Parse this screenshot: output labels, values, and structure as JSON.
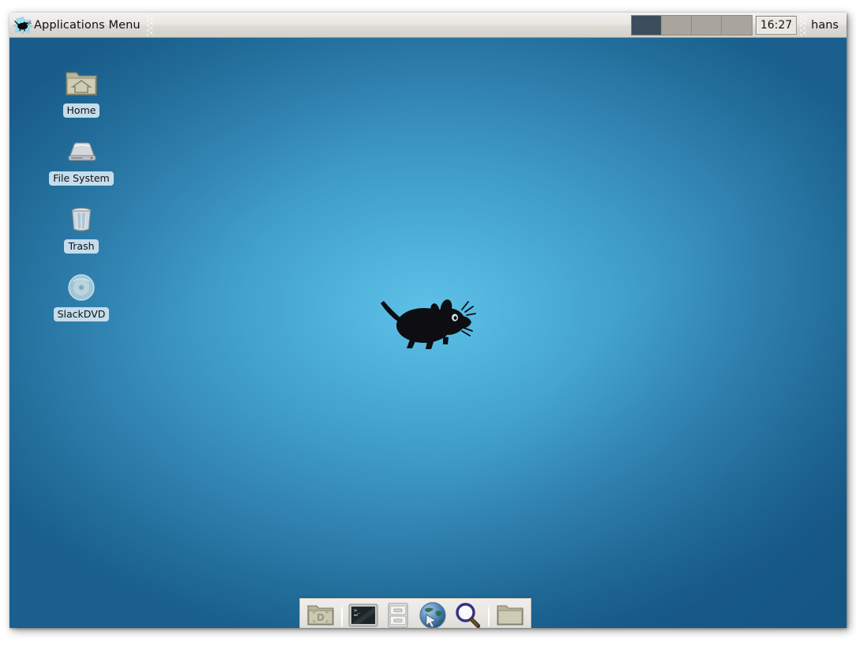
{
  "desktop_environment": {
    "name": "Xfce Desktop",
    "background_colors": {
      "center": "#5ec0e6",
      "mid": "#3f9cc9",
      "edge": "#1a5f8d"
    }
  },
  "top_panel": {
    "applications_menu": {
      "label": "Applications Menu",
      "icon": "xfce-mouse-logo-icon"
    },
    "handle_icon": "panel-drag-handle-icon",
    "workspaces": [
      {
        "name": "Workspace 1",
        "active": true
      },
      {
        "name": "Workspace 2",
        "active": false
      },
      {
        "name": "Workspace 3",
        "active": false
      },
      {
        "name": "Workspace 4",
        "active": false
      }
    ],
    "clock": "16:27",
    "user": "hans"
  },
  "desktop_icons": [
    {
      "label": "Home",
      "icon": "home-folder-icon"
    },
    {
      "label": "File System",
      "icon": "hard-drive-icon"
    },
    {
      "label": "Trash",
      "icon": "trash-can-icon"
    },
    {
      "label": "SlackDVD",
      "icon": "optical-disc-icon"
    }
  ],
  "wallpaper": {
    "logo": "xfce-mouse-silhouette-icon"
  },
  "dock": {
    "items": [
      {
        "label": "Show Desktop",
        "icon": "show-desktop-folder-icon"
      },
      {
        "label": "Terminal Emulator",
        "icon": "terminal-icon"
      },
      {
        "label": "File Manager",
        "icon": "file-cabinet-icon"
      },
      {
        "label": "Web Browser",
        "icon": "globe-browser-icon"
      },
      {
        "label": "Find Files",
        "icon": "magnifier-search-icon"
      },
      {
        "label": "Open Folder",
        "icon": "folder-icon"
      }
    ],
    "separator_icon": "vertical-separator-icon"
  }
}
